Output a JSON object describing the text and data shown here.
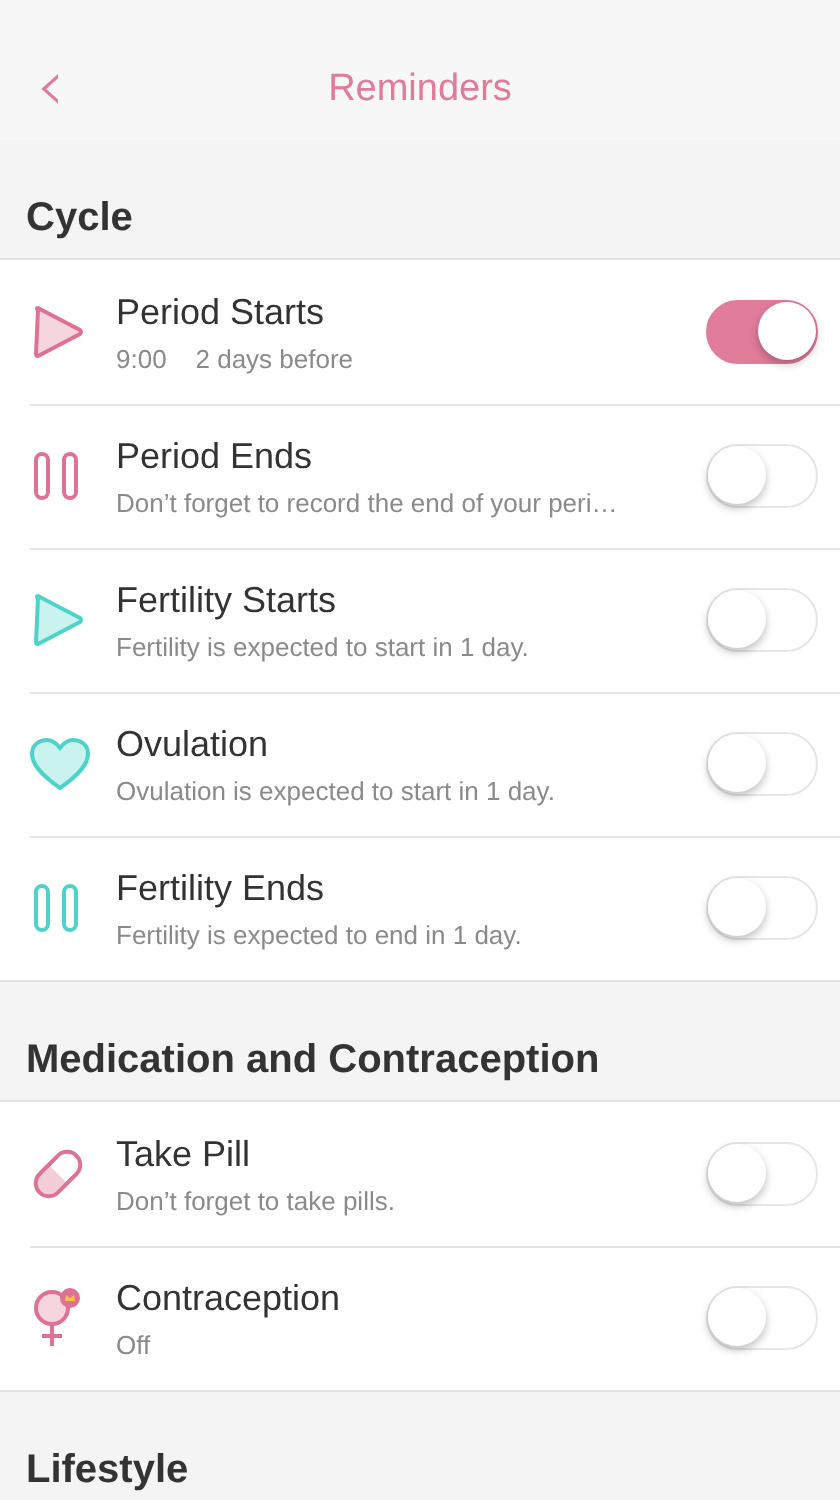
{
  "nav": {
    "back": "‹",
    "title": "Reminders"
  },
  "sections": [
    {
      "title": "Cycle",
      "items": [
        {
          "kind": "play",
          "color": "#dd7393",
          "title": "Period Starts",
          "subtitle": "9:00    2 days before",
          "on": true
        },
        {
          "kind": "pause",
          "color": "#dd7393",
          "title": "Period Ends",
          "subtitle": "Don’t forget to record the end of your peri…",
          "on": false
        },
        {
          "kind": "play",
          "color": "#4fd3c8",
          "title": "Fertility Starts",
          "subtitle": "Fertility is expected to start in 1 day.",
          "on": false
        },
        {
          "kind": "heart",
          "color": "#4fd3c8",
          "title": "Ovulation",
          "subtitle": "Ovulation is expected to start in 1 day.",
          "on": false
        },
        {
          "kind": "pause",
          "color": "#4fd3c8",
          "title": "Fertility Ends",
          "subtitle": "Fertility is expected to end in 1 day.",
          "on": false
        }
      ]
    },
    {
      "title": "Medication and Contraception",
      "items": [
        {
          "kind": "pill",
          "color": "#dd7393",
          "title": "Take Pill",
          "subtitle": "Don’t forget to take pills.",
          "on": false
        },
        {
          "kind": "female",
          "color": "#dd7393",
          "title": "Contraception",
          "subtitle": "Off",
          "on": false
        }
      ]
    },
    {
      "title": "Lifestyle"
    }
  ]
}
